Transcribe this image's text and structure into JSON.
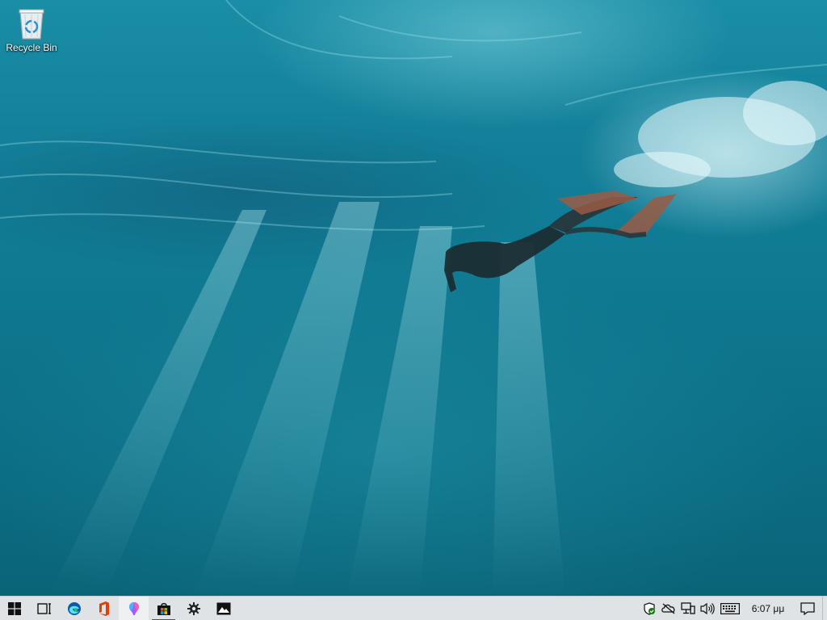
{
  "desktop": {
    "icons": [
      {
        "label": "Recycle Bin",
        "icon": "recycle-bin-icon"
      }
    ],
    "wallpaper": "underwater-freediver"
  },
  "taskbar": {
    "start": {
      "icon": "windows-logo-icon"
    },
    "pinned": [
      {
        "icon": "task-view-icon"
      },
      {
        "icon": "edge-icon"
      },
      {
        "icon": "office-icon"
      },
      {
        "icon": "paint-3d-icon"
      },
      {
        "icon": "microsoft-store-icon"
      },
      {
        "icon": "settings-gear-icon"
      },
      {
        "icon": "photos-icon"
      }
    ],
    "tray": [
      {
        "icon": "windows-security-icon"
      },
      {
        "icon": "onedrive-icon"
      },
      {
        "icon": "network-icon"
      },
      {
        "icon": "volume-icon"
      },
      {
        "icon": "touch-keyboard-icon"
      }
    ],
    "clock": {
      "time": "6:07 μμ"
    },
    "notifications": {
      "icon": "action-center-icon"
    }
  },
  "colors": {
    "taskbar_bg": "#dfe3e6",
    "running_indicator": "#e81123",
    "edge_blue": "#0c59a4",
    "office_red": "#eb3c00",
    "security_green": "#107c10"
  }
}
